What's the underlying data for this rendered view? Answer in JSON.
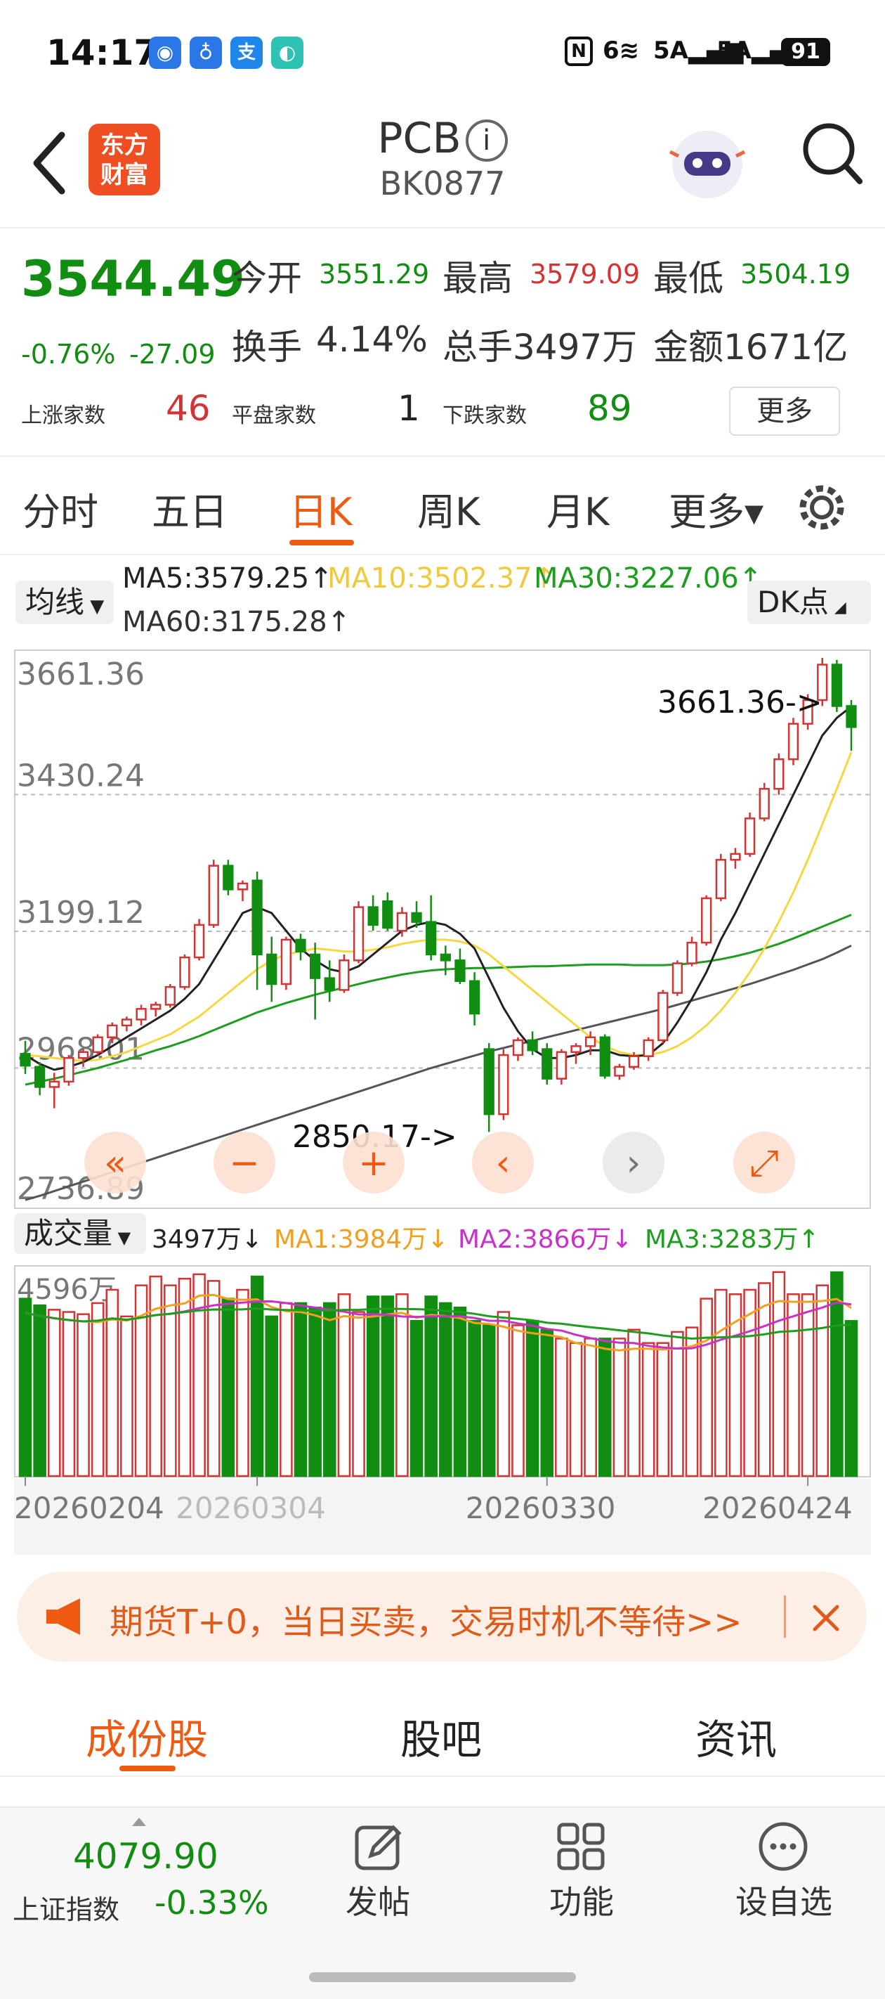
{
  "status": {
    "time": "14:17",
    "icons": [
      "baidu-icon",
      "bulb-icon",
      "alipay-icon",
      "app-icon"
    ],
    "net1": "6",
    "net2": "5A",
    "net3": "5A",
    "battery": "91"
  },
  "header": {
    "back": "chevron-left-icon",
    "logo_line1": "东方",
    "logo_line2": "财富",
    "title": "PCB",
    "code": "BK0877",
    "search": "search-icon"
  },
  "quote": {
    "price": "3544.49",
    "chg_pct": "-0.76%",
    "chg_val": "-27.09",
    "open_label": "今开",
    "open": "3551.29",
    "high_label": "最高",
    "high": "3579.09",
    "low_label": "最低",
    "low": "3504.19",
    "turnover_label": "换手",
    "turnover": "4.14%",
    "vol_label": "总手",
    "vol": "3497万",
    "amt_label": "金额",
    "amt": "1671亿",
    "up_label": "上涨家数",
    "up": "46",
    "flat_label": "平盘家数",
    "flat": "1",
    "down_label": "下跌家数",
    "down": "89",
    "more": "更多"
  },
  "tabs": [
    "分时",
    "五日",
    "日K",
    "周K",
    "月K",
    "更多▾"
  ],
  "ma": {
    "pill": "均线",
    "ma5": "MA5:3579.25↑",
    "ma10": "MA10:3502.37↑",
    "ma30": "MA30:3227.06↑",
    "ma60": "MA60:3175.28↑",
    "dk": "DK点"
  },
  "colors": {
    "up": "#d53333",
    "down": "#118e12",
    "accent": "#ef5a12",
    "ma5": "#222222",
    "ma10": "#f5d742",
    "ma30": "#1e9e1e",
    "ma60": "#555555"
  },
  "chart_data": {
    "type": "candlestick",
    "ylim": [
      2736.89,
      3661.36
    ],
    "y_ticks": [
      "3661.36",
      "3430.24",
      "3199.12",
      "2968.01",
      "2736.89"
    ],
    "max_label": "3661.36->",
    "min_label": "2850.17->",
    "x_ticks": [
      "20260204",
      "20260304",
      "20260330",
      "20260424"
    ],
    "candles": [
      [
        2992,
        3014,
        2958,
        2972
      ],
      [
        2970,
        2978,
        2922,
        2936
      ],
      [
        2936,
        2960,
        2900,
        2945
      ],
      [
        2945,
        2990,
        2938,
        2985
      ],
      [
        2985,
        3000,
        2970,
        2995
      ],
      [
        2995,
        3025,
        2990,
        3020
      ],
      [
        3020,
        3045,
        3010,
        3040
      ],
      [
        3040,
        3055,
        3030,
        3050
      ],
      [
        3050,
        3075,
        3040,
        3068
      ],
      [
        3068,
        3080,
        3055,
        3075
      ],
      [
        3075,
        3110,
        3070,
        3105
      ],
      [
        3105,
        3160,
        3100,
        3155
      ],
      [
        3155,
        3220,
        3150,
        3210
      ],
      [
        3210,
        3320,
        3205,
        3310
      ],
      [
        3310,
        3320,
        3260,
        3270
      ],
      [
        3270,
        3285,
        3250,
        3280
      ],
      [
        3285,
        3300,
        3100,
        3160
      ],
      [
        3160,
        3190,
        3080,
        3110
      ],
      [
        3110,
        3190,
        3100,
        3185
      ],
      [
        3185,
        3195,
        3150,
        3165
      ],
      [
        3160,
        3180,
        3050,
        3120
      ],
      [
        3120,
        3150,
        3080,
        3100
      ],
      [
        3100,
        3160,
        3095,
        3150
      ],
      [
        3150,
        3250,
        3145,
        3240
      ],
      [
        3240,
        3260,
        3200,
        3210
      ],
      [
        3250,
        3265,
        3200,
        3205
      ],
      [
        3200,
        3240,
        3190,
        3230
      ],
      [
        3230,
        3250,
        3205,
        3215
      ],
      [
        3215,
        3260,
        3150,
        3160
      ],
      [
        3160,
        3175,
        3125,
        3150
      ],
      [
        3150,
        3170,
        3110,
        3115
      ],
      [
        3115,
        3130,
        3040,
        3060
      ],
      [
        3000,
        3010,
        2860,
        2890
      ],
      [
        2890,
        3000,
        2880,
        2990
      ],
      [
        2990,
        3020,
        2980,
        3015
      ],
      [
        3015,
        3030,
        2990,
        2998
      ],
      [
        3000,
        3010,
        2940,
        2950
      ],
      [
        2950,
        3000,
        2940,
        2995
      ],
      [
        2995,
        3010,
        2975,
        3005
      ],
      [
        3005,
        3030,
        2990,
        3020
      ],
      [
        3020,
        3025,
        2950,
        2955
      ],
      [
        2955,
        2975,
        2948,
        2970
      ],
      [
        2970,
        2995,
        2965,
        2988
      ],
      [
        2988,
        3020,
        2980,
        3015
      ],
      [
        3015,
        3100,
        3010,
        3095
      ],
      [
        3095,
        3150,
        3090,
        3145
      ],
      [
        3145,
        3190,
        3140,
        3180
      ],
      [
        3180,
        3260,
        3175,
        3255
      ],
      [
        3255,
        3330,
        3250,
        3320
      ],
      [
        3320,
        3340,
        3305,
        3330
      ],
      [
        3330,
        3400,
        3325,
        3390
      ],
      [
        3390,
        3450,
        3385,
        3440
      ],
      [
        3440,
        3500,
        3430,
        3490
      ],
      [
        3490,
        3560,
        3480,
        3550
      ],
      [
        3550,
        3600,
        3540,
        3590
      ],
      [
        3590,
        3661.36,
        3580,
        3650
      ],
      [
        3650,
        3658,
        3570,
        3580
      ],
      [
        3580,
        3590,
        3504.19,
        3544.49
      ]
    ],
    "ma": {
      "ma5": [
        2990,
        2975,
        2965,
        2970,
        2978,
        2990,
        3005,
        3020,
        3035,
        3050,
        3065,
        3085,
        3110,
        3150,
        3190,
        3230,
        3240,
        3230,
        3200,
        3170,
        3150,
        3135,
        3130,
        3140,
        3160,
        3180,
        3200,
        3210,
        3215,
        3210,
        3195,
        3170,
        3120,
        3070,
        3030,
        3000,
        2985,
        2985,
        2990,
        2998,
        2998,
        2990,
        2988,
        2990,
        3010,
        3045,
        3085,
        3130,
        3185,
        3230,
        3280,
        3330,
        3380,
        3430,
        3480,
        3530,
        3560,
        3579
      ],
      "ma10": [
        2990,
        2988,
        2985,
        2982,
        2980,
        2982,
        2988,
        2995,
        3005,
        3015,
        3025,
        3040,
        3055,
        3075,
        3095,
        3115,
        3135,
        3150,
        3160,
        3165,
        3170,
        3168,
        3165,
        3165,
        3168,
        3172,
        3178,
        3182,
        3185,
        3185,
        3182,
        3175,
        3160,
        3140,
        3120,
        3100,
        3080,
        3060,
        3040,
        3020,
        3005,
        2995,
        2990,
        2990,
        2995,
        3005,
        3020,
        3040,
        3065,
        3095,
        3130,
        3170,
        3215,
        3265,
        3320,
        3380,
        3440,
        3502
      ],
      "ma30": [
        2940,
        2945,
        2950,
        2956,
        2962,
        2968,
        2975,
        2982,
        2990,
        2998,
        3005,
        3013,
        3022,
        3032,
        3042,
        3052,
        3062,
        3070,
        3078,
        3085,
        3092,
        3098,
        3104,
        3110,
        3116,
        3121,
        3126,
        3130,
        3133,
        3135,
        3136,
        3137,
        3137,
        3138,
        3139,
        3140,
        3140,
        3141,
        3142,
        3143,
        3143,
        3143,
        3142,
        3142,
        3142,
        3143,
        3145,
        3148,
        3152,
        3157,
        3163,
        3170,
        3178,
        3187,
        3197,
        3207,
        3217,
        3227
      ],
      "ma60": [
        2745,
        2752,
        2760,
        2768,
        2776,
        2784,
        2792,
        2800,
        2808,
        2816,
        2824,
        2832,
        2840,
        2848,
        2856,
        2864,
        2872,
        2880,
        2888,
        2896,
        2904,
        2912,
        2920,
        2928,
        2936,
        2944,
        2952,
        2960,
        2968,
        2975,
        2982,
        2989,
        2996,
        3002,
        3008,
        3014,
        3020,
        3026,
        3032,
        3038,
        3044,
        3050,
        3056,
        3062,
        3068,
        3075,
        3082,
        3089,
        3096,
        3103,
        3110,
        3118,
        3126,
        3134,
        3143,
        3152,
        3163,
        3175
      ]
    },
    "volume": {
      "label": "成交量",
      "value": "3497万↓",
      "ma1": "MA1:3984万↓",
      "ma2": "MA2:3866万↓",
      "ma3": "MA3:3283万↑",
      "max_label": "4596万",
      "ylim": [
        0,
        4596
      ],
      "bars": [
        4000,
        3850,
        3750,
        3700,
        3650,
        3900,
        4200,
        3600,
        4300,
        4500,
        4300,
        4450,
        4550,
        4400,
        4000,
        4200,
        4500,
        3600,
        3900,
        3900,
        3800,
        3900,
        4100,
        3700,
        4050,
        4050,
        4100,
        3500,
        4050,
        3900,
        3800,
        3500,
        3400,
        3700,
        3400,
        3500,
        3300,
        3100,
        3000,
        3100,
        3100,
        3100,
        3300,
        3000,
        3000,
        3250,
        3350,
        4000,
        4200,
        4100,
        4200,
        4350,
        4600,
        4100,
        4100,
        4300,
        4596,
        3497
      ]
    }
  },
  "banner": {
    "text": "期货T+0，当日买卖，交易时机不等待>>",
    "close": "close-icon"
  },
  "btabs": [
    "成份股",
    "股吧",
    "资讯"
  ],
  "bottom": {
    "index_val": "4079.90",
    "index_name": "上证指数",
    "index_chg": "-0.33%",
    "post": "发帖",
    "func": "功能",
    "fav": "设自选"
  }
}
